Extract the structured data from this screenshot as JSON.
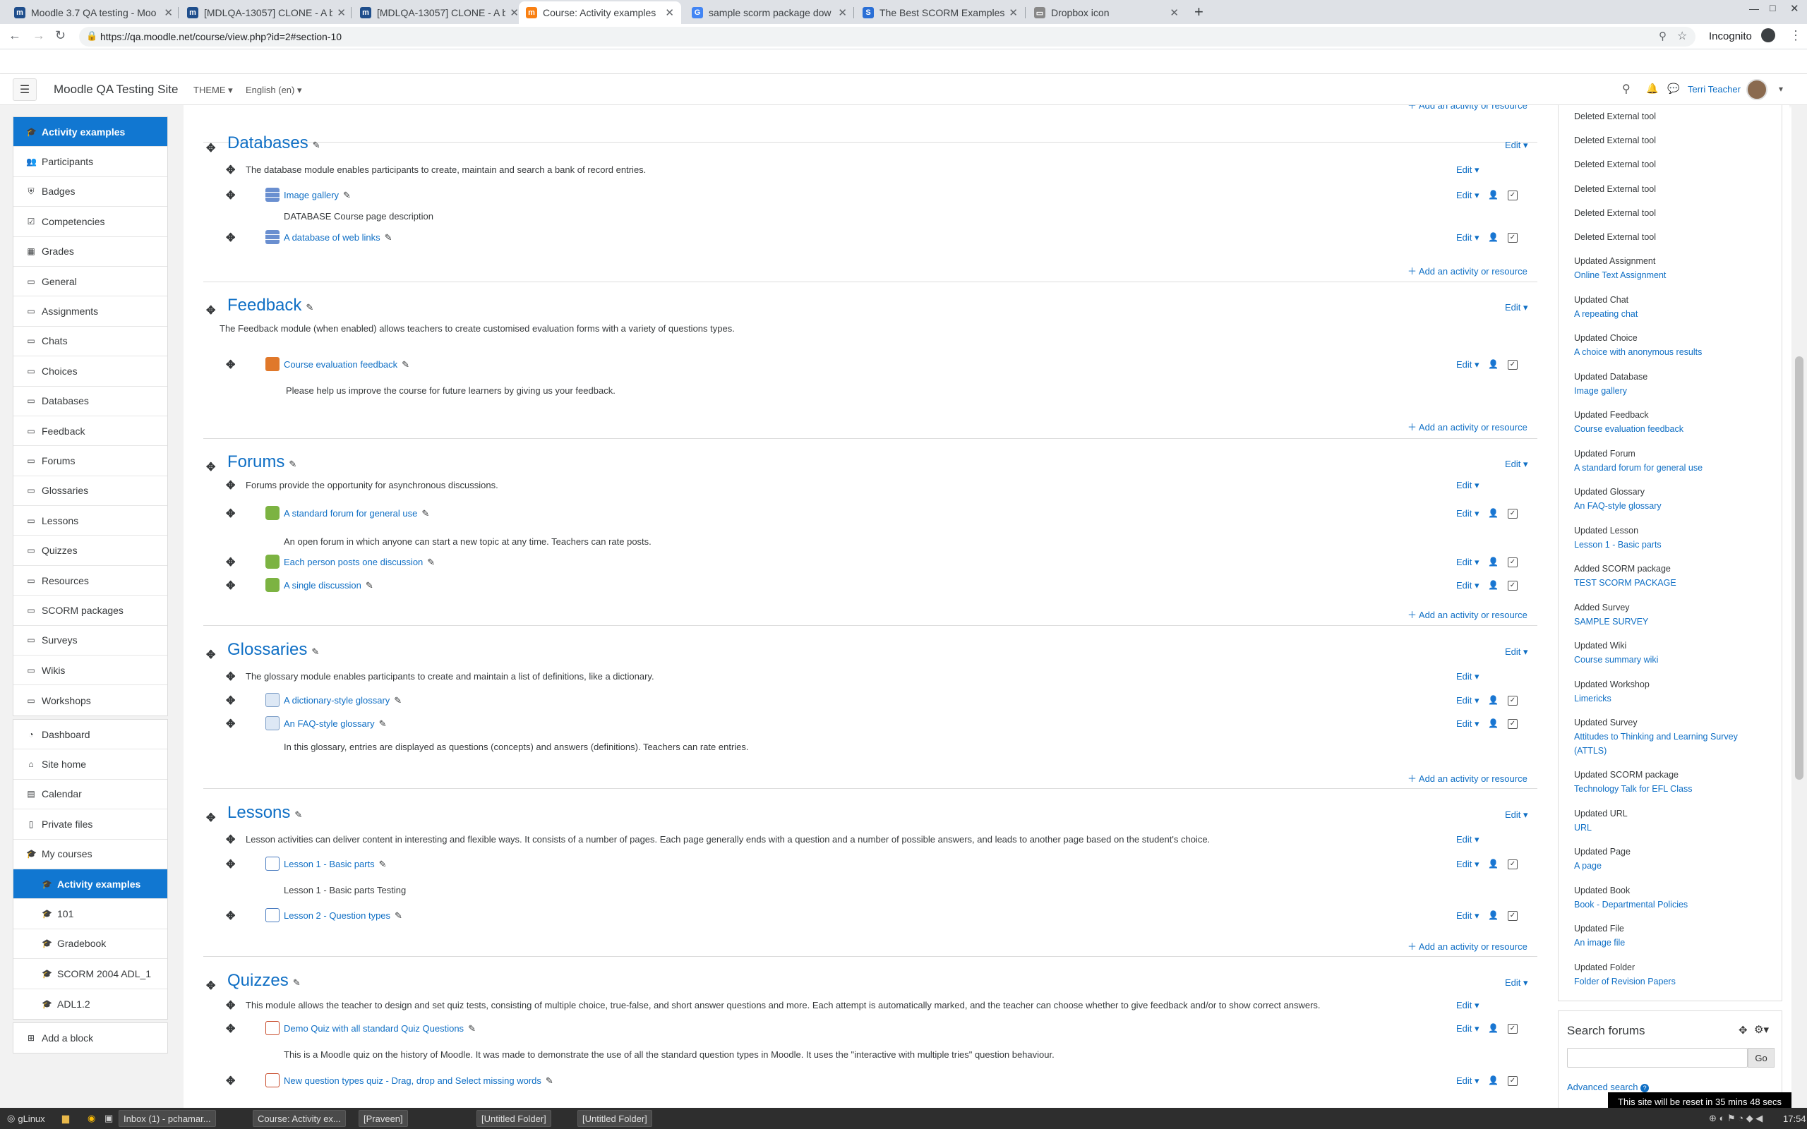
{
  "browser": {
    "tabs": [
      {
        "title": "Moodle 3.7 QA testing - Moo",
        "icon": "moodle-icon",
        "active": false
      },
      {
        "title": "[MDLQA-13057] CLONE - A b",
        "icon": "moodle-icon",
        "active": false
      },
      {
        "title": "[MDLQA-13057] CLONE - A b",
        "icon": "moodle-icon",
        "active": false
      },
      {
        "title": "Course: Activity examples",
        "icon": "moodle-hat-icon",
        "active": true
      },
      {
        "title": "sample scorm package dow",
        "icon": "google-icon",
        "active": false
      },
      {
        "title": "The Best SCORM Examples: S",
        "icon": "s-icon",
        "active": false
      },
      {
        "title": "Dropbox icon",
        "icon": "page-icon",
        "active": false
      }
    ],
    "url": "https://qa.moodle.net/course/view.php?id=2#section-10",
    "profile_label": "Incognito"
  },
  "navbar": {
    "site_name": "Moodle QA Testing Site",
    "theme_label": "THEME",
    "language_label": "English (en)",
    "user_name": "Terri Teacher"
  },
  "drawer": {
    "course_items": [
      {
        "label": "Activity examples",
        "icon": "graduation-cap-icon",
        "active": true
      },
      {
        "label": "Participants",
        "icon": "users-icon"
      },
      {
        "label": "Badges",
        "icon": "shield-icon"
      },
      {
        "label": "Competencies",
        "icon": "check-square-icon"
      },
      {
        "label": "Grades",
        "icon": "table-icon"
      },
      {
        "label": "General",
        "icon": "folder-icon"
      },
      {
        "label": "Assignments",
        "icon": "folder-icon"
      },
      {
        "label": "Chats",
        "icon": "folder-icon"
      },
      {
        "label": "Choices",
        "icon": "folder-icon"
      },
      {
        "label": "Databases",
        "icon": "folder-icon"
      },
      {
        "label": "Feedback",
        "icon": "folder-icon"
      },
      {
        "label": "Forums",
        "icon": "folder-icon"
      },
      {
        "label": "Glossaries",
        "icon": "folder-icon"
      },
      {
        "label": "Lessons",
        "icon": "folder-icon"
      },
      {
        "label": "Quizzes",
        "icon": "folder-icon"
      },
      {
        "label": "Resources",
        "icon": "folder-icon"
      },
      {
        "label": "SCORM packages",
        "icon": "folder-icon"
      },
      {
        "label": "Surveys",
        "icon": "folder-icon"
      },
      {
        "label": "Wikis",
        "icon": "folder-icon"
      },
      {
        "label": "Workshops",
        "icon": "folder-icon"
      }
    ],
    "site_items": [
      {
        "label": "Dashboard",
        "icon": "tachometer-icon"
      },
      {
        "label": "Site home",
        "icon": "home-icon"
      },
      {
        "label": "Calendar",
        "icon": "calendar-icon"
      },
      {
        "label": "Private files",
        "icon": "file-icon"
      },
      {
        "label": "My courses",
        "icon": "graduation-cap-icon"
      },
      {
        "label": "Activity examples",
        "icon": "graduation-cap-icon",
        "active": true,
        "indent": true
      },
      {
        "label": "101",
        "icon": "graduation-cap-icon",
        "indent": true
      },
      {
        "label": "Gradebook",
        "icon": "graduation-cap-icon",
        "indent": true
      },
      {
        "label": "SCORM 2004 ADL_1",
        "icon": "graduation-cap-icon",
        "indent": true
      },
      {
        "label": "ADL1.2",
        "icon": "graduation-cap-icon",
        "indent": true
      }
    ],
    "add_block": "Add a block"
  },
  "main": {
    "edit_label": "Edit",
    "add_label": "Add an activity or resource",
    "sections": [
      {
        "title": "Databases",
        "summary": "The database module enables participants to create, maintain and search a bank of record entries.",
        "activities": [
          {
            "name": "Image gallery",
            "icon": "database-icon",
            "desc": "DATABASE Course page description"
          },
          {
            "name": "A database of web links",
            "icon": "database-icon",
            "desc": ""
          }
        ]
      },
      {
        "title": "Feedback",
        "summary": "The Feedback module (when enabled) allows teachers to create customised evaluation forms with a variety of questions types.",
        "activities": [
          {
            "name": "Course evaluation feedback",
            "icon": "megaphone-icon",
            "desc": "Please help us improve the course for future learners by giving us your feedback."
          }
        ]
      },
      {
        "title": "Forums",
        "summary": "Forums provide the opportunity for asynchronous discussions.",
        "activities": [
          {
            "name": "A standard forum for general use",
            "icon": "forum-icon",
            "desc": "An open forum in which anyone can start a new topic at any time. Teachers can rate posts."
          },
          {
            "name": "Each person posts one discussion",
            "icon": "forum-icon",
            "desc": ""
          },
          {
            "name": "A single discussion",
            "icon": "forum-icon",
            "desc": ""
          }
        ]
      },
      {
        "title": "Glossaries",
        "summary": "The glossary module enables participants to create and maintain a list of definitions, like a dictionary.",
        "activities": [
          {
            "name": "A dictionary-style glossary",
            "icon": "glossary-icon",
            "desc": ""
          },
          {
            "name": "An FAQ-style glossary",
            "icon": "glossary-icon",
            "desc": "In this glossary, entries are displayed as questions (concepts) and answers (definitions). Teachers can rate entries."
          }
        ]
      },
      {
        "title": "Lessons",
        "summary": "Lesson activities can deliver content in interesting and flexible ways. It consists of a number of pages. Each page generally ends with a question and a number of possible answers, and leads to another page based on the student's choice.",
        "activities": [
          {
            "name": "Lesson 1 - Basic parts",
            "icon": "lesson-icon",
            "desc": "Lesson 1 - Basic parts Testing"
          },
          {
            "name": "Lesson 2 - Question types",
            "icon": "lesson-icon",
            "desc": ""
          }
        ]
      },
      {
        "title": "Quizzes",
        "summary": "This module allows the teacher to design and set quiz tests, consisting of multiple choice, true-false, and short answer questions and more. Each attempt is automatically marked, and the teacher can choose whether to give feedback and/or to show correct answers.",
        "activities": [
          {
            "name": "Demo Quiz with all standard Quiz Questions",
            "icon": "quiz-icon",
            "desc": "This is a Moodle quiz on the history of Moodle. It was made to demonstrate the use of all the standard question types in Moodle. It uses the \"interactive with multiple tries\" question behaviour."
          },
          {
            "name": "New question types quiz - Drag, drop and Select missing words",
            "icon": "quiz-icon",
            "desc": ""
          }
        ]
      }
    ]
  },
  "recent_activity": [
    {
      "label": "Deleted External tool",
      "link": ""
    },
    {
      "label": "Deleted External tool",
      "link": ""
    },
    {
      "label": "Deleted External tool",
      "link": ""
    },
    {
      "label": "Deleted External tool",
      "link": ""
    },
    {
      "label": "Deleted External tool",
      "link": ""
    },
    {
      "label": "Deleted External tool",
      "link": ""
    },
    {
      "label": "Updated Assignment",
      "link": "Online Text Assignment"
    },
    {
      "label": "Updated Chat",
      "link": "A repeating chat"
    },
    {
      "label": "Updated Choice",
      "link": "A choice with anonymous results"
    },
    {
      "label": "Updated Database",
      "link": "Image gallery"
    },
    {
      "label": "Updated Feedback",
      "link": "Course evaluation feedback"
    },
    {
      "label": "Updated Forum",
      "link": "A standard forum for general use"
    },
    {
      "label": "Updated Glossary",
      "link": "An FAQ-style glossary"
    },
    {
      "label": "Updated Lesson",
      "link": "Lesson 1 - Basic parts"
    },
    {
      "label": "Added SCORM package",
      "link": "TEST SCORM PACKAGE"
    },
    {
      "label": "Added Survey",
      "link": "SAMPLE SURVEY"
    },
    {
      "label": "Updated Wiki",
      "link": "Course summary wiki"
    },
    {
      "label": "Updated Workshop",
      "link": "Limericks"
    },
    {
      "label": "Updated Survey",
      "link": "Attitudes to Thinking and Learning Survey",
      "link2": "(ATTLS)"
    },
    {
      "label": "Updated SCORM package",
      "link": "Technology Talk for EFL Class"
    },
    {
      "label": "Updated URL",
      "link": "URL"
    },
    {
      "label": "Updated Page",
      "link": "A page"
    },
    {
      "label": "Updated Book",
      "link": "Book - Departmental Policies"
    },
    {
      "label": "Updated File",
      "link": "An image file"
    },
    {
      "label": "Updated Folder",
      "link": "Folder of Revision Papers"
    }
  ],
  "search_forums": {
    "title": "Search forums",
    "go_label": "Go",
    "advanced_label": "Advanced search"
  },
  "toast": "This site will be reset in 35 mins 48 secs",
  "taskbar": {
    "start_label": "gLinux",
    "windows": [
      "Inbox (1) - pchamar...",
      "Course: Activity ex...",
      "[Praveen]",
      "[Untitled Folder]",
      "[Untitled Folder]"
    ],
    "clock": "17:54"
  },
  "colors": {
    "accent": "#1177d1",
    "link": "#0f6fc5"
  }
}
